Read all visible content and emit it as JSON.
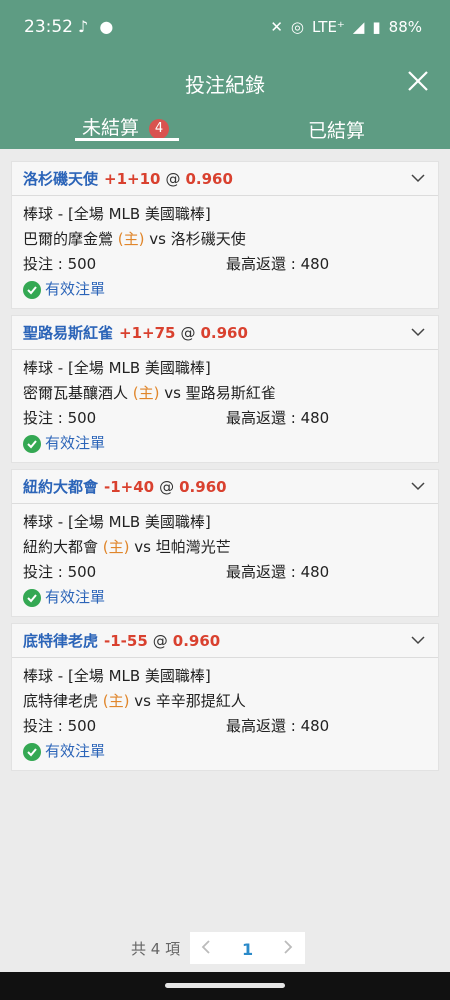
{
  "status": {
    "time": "23:52",
    "network": "LTE⁺",
    "battery": "88%"
  },
  "header": {
    "title": "投注紀錄",
    "close_icon": "close-icon"
  },
  "tabs": {
    "pending_label": "未結算",
    "pending_count": "4",
    "settled_label": "已結算"
  },
  "bets": [
    {
      "team": "洛杉磯天使",
      "handicap": "+1+10",
      "at": "@",
      "odds": "0.960",
      "sport": "棒球 - [全場 MLB 美國職棒]",
      "home_team": "巴爾的摩金鶯",
      "home_tag": "(主)",
      "vs": "vs",
      "away_team": "洛杉磯天使",
      "stake": "投注 : 500",
      "max_return": "最高返還 : 480",
      "status": "有效注單"
    },
    {
      "team": "聖路易斯紅雀",
      "handicap": "+1+75",
      "at": "@",
      "odds": "0.960",
      "sport": "棒球 - [全場 MLB 美國職棒]",
      "home_team": "密爾瓦基釀酒人",
      "home_tag": "(主)",
      "vs": "vs",
      "away_team": "聖路易斯紅雀",
      "stake": "投注 : 500",
      "max_return": "最高返還 : 480",
      "status": "有效注單"
    },
    {
      "team": "紐約大都會",
      "handicap": "-1+40",
      "at": "@",
      "odds": "0.960",
      "sport": "棒球 - [全場 MLB 美國職棒]",
      "home_team": "紐約大都會",
      "home_tag": "(主)",
      "vs": "vs",
      "away_team": "坦帕灣光芒",
      "stake": "投注 : 500",
      "max_return": "最高返還 : 480",
      "status": "有效注單"
    },
    {
      "team": "底特律老虎",
      "handicap": "-1-55",
      "at": "@",
      "odds": "0.960",
      "sport": "棒球 - [全場 MLB 美國職棒]",
      "home_team": "底特律老虎",
      "home_tag": "(主)",
      "vs": "vs",
      "away_team": "辛辛那提紅人",
      "stake": "投注 : 500",
      "max_return": "最高返還 : 480",
      "status": "有效注單"
    }
  ],
  "pagination": {
    "total": "共 4 項",
    "current_page": "1",
    "prev_icon": "chevron-left-icon",
    "next_icon": "chevron-right-icon"
  },
  "colors": {
    "header_bg": "#5e9c83",
    "team_blue": "#2b64b8",
    "odds_red": "#d9412f",
    "home_orange": "#e0862b",
    "valid_green": "#34a853",
    "badge_red": "#d9534f"
  }
}
